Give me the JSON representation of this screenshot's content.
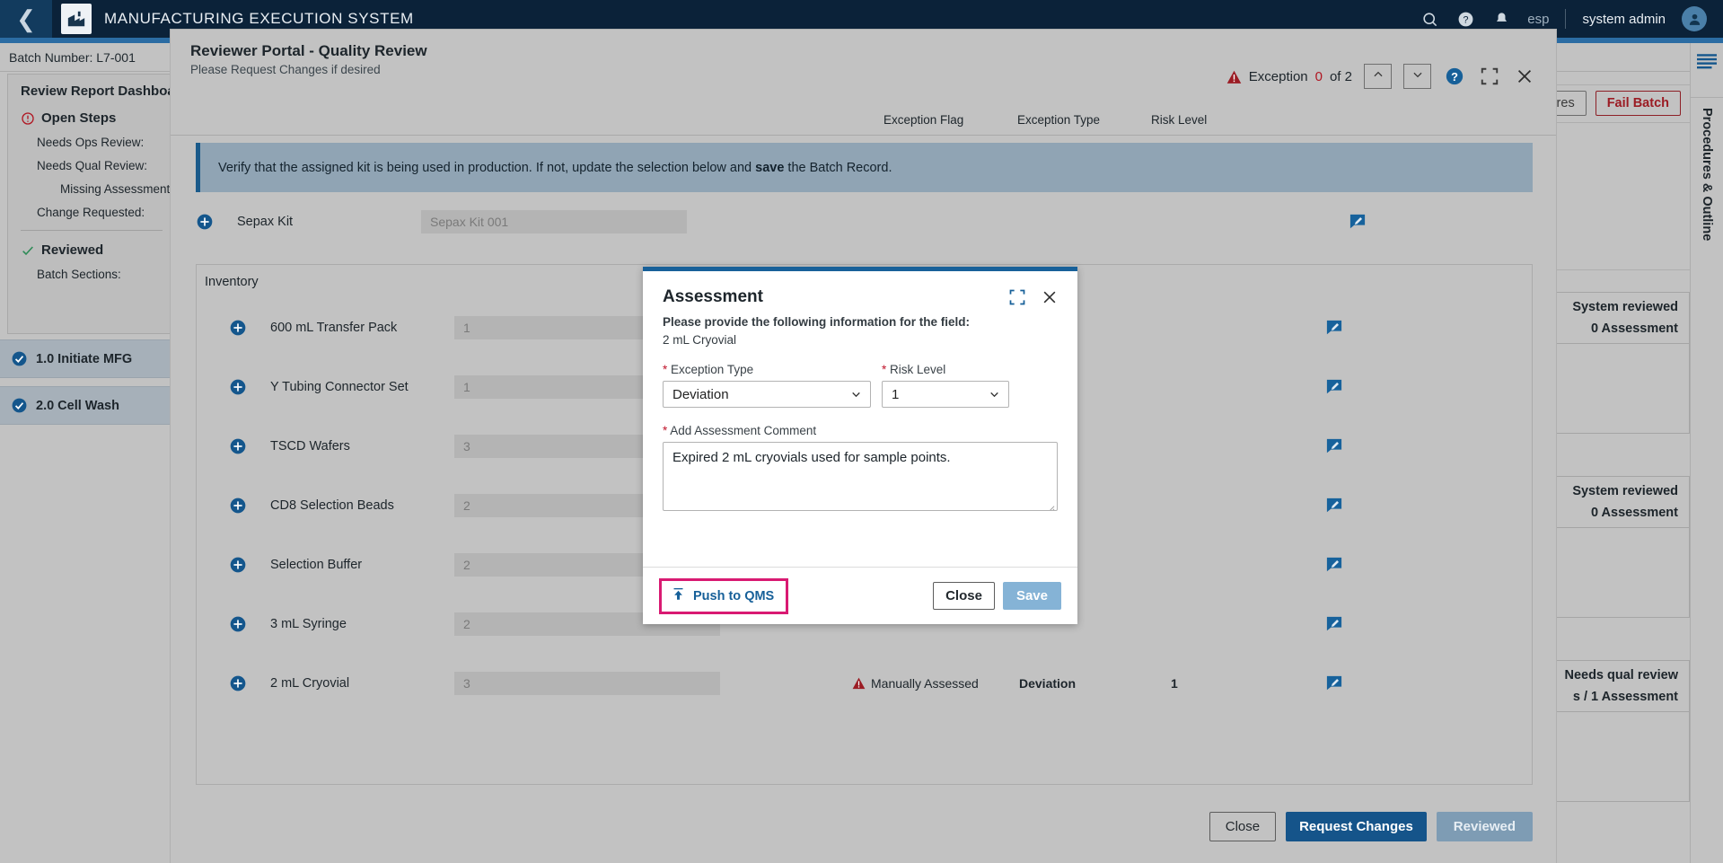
{
  "appbar": {
    "back_icon": "chevron-left-icon",
    "logo_icon": "factory-icon",
    "title": "MANUFACTURING EXECUTION SYSTEM",
    "search_icon": "search-icon",
    "help_icon": "help-circle-icon",
    "notification_icon": "bell-icon",
    "locale": "esp",
    "username": "system admin",
    "avatar_icon": "user-avatar-icon"
  },
  "background": {
    "batch_label": "Batch Number: L7-001",
    "left_panel": {
      "title": "Review Report Dashboard",
      "open_steps": {
        "icon": "alert-circle-icon",
        "label": "Open Steps",
        "items": [
          "Needs Ops Review:",
          "Needs Qual Review:",
          "Missing Assessment",
          "Change Requested:"
        ]
      },
      "reviewed": {
        "icon": "check-icon",
        "label": "Reviewed",
        "items": [
          "Batch Sections:"
        ]
      }
    },
    "steps": [
      {
        "icon": "check-circle-filled-icon",
        "label": "1.0 Initiate MFG"
      },
      {
        "icon": "check-circle-filled-icon",
        "label": "2.0 Cell Wash"
      }
    ],
    "toolbar": {
      "signatures_label": "Signatures",
      "fail_batch_label": "Fail Batch"
    },
    "stat_cards": [
      {
        "line1": "System reviewed",
        "line2": "0 Assessment"
      },
      {
        "line1": "System reviewed",
        "line2": "0 Assessment"
      },
      {
        "line1": "Needs qual review",
        "line2": "s / 1 Assessment"
      }
    ],
    "right_rail": {
      "hamburger_icon": "menu-icon",
      "label": "Procedures & Outline"
    }
  },
  "modal": {
    "title": "Reviewer Portal - Quality Review",
    "subtitle": "Please Request Changes if desired",
    "exception": {
      "warn_icon": "triangle-warning-icon",
      "prefix": "Exception",
      "count": "0",
      "suffix": "of 2",
      "prev_icon": "chevron-up-icon",
      "next_icon": "chevron-down-icon"
    },
    "help_icon": "help-circle-filled-icon",
    "expand_icon": "fullscreen-icon",
    "close_icon": "close-icon",
    "columns": [
      "Exception Flag",
      "Exception Type",
      "Risk Level"
    ],
    "banner": {
      "text_before": "Verify that the assigned kit is being used in production. If not, update the selection below and ",
      "text_bold": "save",
      "text_after": " the Batch Record."
    },
    "kit_row": {
      "add_icon": "plus-circle-icon",
      "label": "Sepax Kit",
      "value": "Sepax Kit 001",
      "edit_icon": "comment-edit-icon"
    },
    "inventory": {
      "title": "Inventory",
      "rows": [
        {
          "add_icon": "plus-circle-icon",
          "label": "600 mL Transfer Pack",
          "value": "1",
          "flag": "",
          "type": "",
          "risk": "",
          "edit_icon": "comment-edit-icon"
        },
        {
          "add_icon": "plus-circle-icon",
          "label": "Y Tubing Connector Set",
          "value": "1",
          "flag": "",
          "type": "",
          "risk": "",
          "edit_icon": "comment-edit-icon"
        },
        {
          "add_icon": "plus-circle-icon",
          "label": "TSCD Wafers",
          "value": "3",
          "flag": "",
          "type": "",
          "risk": "",
          "edit_icon": "comment-edit-icon"
        },
        {
          "add_icon": "plus-circle-icon",
          "label": "CD8 Selection Beads",
          "value": "2",
          "flag": "",
          "type": "",
          "risk": "",
          "edit_icon": "comment-edit-icon"
        },
        {
          "add_icon": "plus-circle-icon",
          "label": "Selection Buffer",
          "value": "2",
          "flag": "",
          "type": "",
          "risk": "",
          "edit_icon": "comment-edit-icon"
        },
        {
          "add_icon": "plus-circle-icon",
          "label": "3 mL Syringe",
          "value": "2",
          "flag": "",
          "type": "",
          "risk": "",
          "edit_icon": "comment-edit-icon"
        },
        {
          "add_icon": "plus-circle-icon",
          "label": "2 mL Cryovial",
          "value": "3",
          "flag": "Manually Assessed",
          "flag_icon": "triangle-warning-icon",
          "type": "Deviation",
          "risk": "1",
          "edit_icon": "comment-edit-icon"
        }
      ]
    },
    "footer": {
      "close_label": "Close",
      "request_changes_label": "Request Changes",
      "reviewed_label": "Reviewed"
    }
  },
  "dialog": {
    "title": "Assessment",
    "subtitle_line1": "Please provide the following information for the field:",
    "subtitle_line2": "2 mL Cryovial",
    "expand_icon": "fullscreen-icon",
    "close_icon": "close-icon",
    "exception_type": {
      "label": "Exception Type",
      "value": "Deviation",
      "required": "*",
      "chevron_icon": "chevron-down-icon"
    },
    "risk_level": {
      "label": "Risk Level",
      "value": "1",
      "required": "*",
      "chevron_icon": "chevron-down-icon"
    },
    "comment": {
      "label": "Add Assessment Comment",
      "required": "*",
      "value": "Expired 2 mL cryovials used for sample points."
    },
    "push_to_qms": {
      "label": "Push to QMS",
      "icon": "upload-icon",
      "highlight_color": "#d91a72"
    },
    "close_label": "Close",
    "save_label": "Save"
  },
  "colors": {
    "appbar_bg": "#0b2239",
    "accent_blue": "#176099",
    "primary_button": "#15548a",
    "highlight_pink": "#d91a72",
    "danger_red": "#b01622",
    "page_bg": "#c2c2c2"
  }
}
